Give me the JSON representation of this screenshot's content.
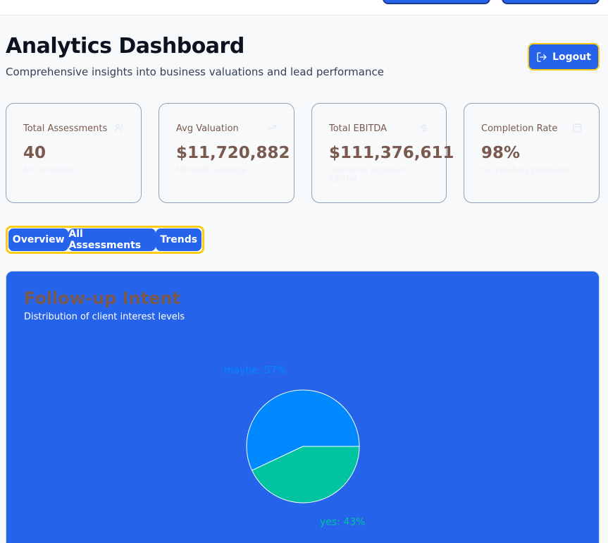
{
  "header": {
    "title": "Analytics Dashboard",
    "subtitle": "Comprehensive insights into business valuations and lead performance",
    "logout_label": "Logout"
  },
  "stats": [
    {
      "label": "Total Assessments",
      "value": "40",
      "note": "All completed",
      "icon": "users-icon"
    },
    {
      "label": "Avg Valuation",
      "value": "$11,720,882",
      "note": "Mid-point average",
      "icon": "trending-up-icon"
    },
    {
      "label": "Total EBITDA",
      "value": "$111,376,611",
      "note": "Combined adjusted EBITDA",
      "icon": "dollar-icon"
    },
    {
      "label": "Completion Rate",
      "value": "98%",
      "note": "Successfully processed",
      "icon": "calendar-icon"
    }
  ],
  "tabs": [
    {
      "label": "Overview"
    },
    {
      "label": "All Assessments"
    },
    {
      "label": "Trends"
    }
  ],
  "panel": {
    "title": "Follow-up Intent",
    "subtitle": "Distribution of client interest levels"
  },
  "chart_data": {
    "type": "pie",
    "title": "Follow-up Intent",
    "slices": [
      {
        "name": "maybe",
        "value": 57,
        "color": "#0088fe",
        "label": "maybe: 57%"
      },
      {
        "name": "yes",
        "value": 43,
        "color": "#00c49f",
        "label": "yes: 43%"
      }
    ]
  },
  "colors": {
    "accent": "#2563eb",
    "highlight": "#facc15",
    "stat_text": "#7a5a4e"
  }
}
